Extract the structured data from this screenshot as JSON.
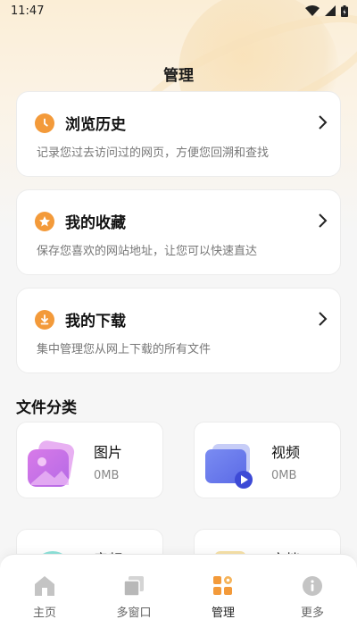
{
  "status_bar": {
    "time": "11:47"
  },
  "page": {
    "title": "管理"
  },
  "cards": [
    {
      "title": "浏览历史",
      "desc": "记录您过去访问过的网页，方便您回溯和查找",
      "icon": "clock-icon"
    },
    {
      "title": "我的收藏",
      "desc": "保存您喜欢的网站地址，让您可以快速直达",
      "icon": "star-icon"
    },
    {
      "title": "我的下载",
      "desc": "集中管理您从网上下载的所有文件",
      "icon": "download-icon"
    }
  ],
  "file_section": {
    "title": "文件分类",
    "tiles": [
      {
        "name": "图片",
        "size": "0MB",
        "icon": "image-icon"
      },
      {
        "name": "视频",
        "size": "0MB",
        "icon": "video-icon"
      },
      {
        "name": "音频",
        "size": "",
        "icon": "audio-icon"
      },
      {
        "name": "文档",
        "size": "",
        "icon": "document-icon"
      }
    ]
  },
  "tabs": [
    {
      "label": "主页",
      "icon": "home-icon"
    },
    {
      "label": "多窗口",
      "icon": "windows-icon"
    },
    {
      "label": "管理",
      "icon": "manage-icon",
      "active": true
    },
    {
      "label": "更多",
      "icon": "more-icon"
    }
  ],
  "colors": {
    "accent": "#f39a3a",
    "background": "#f6f6f6",
    "card": "#ffffff"
  }
}
